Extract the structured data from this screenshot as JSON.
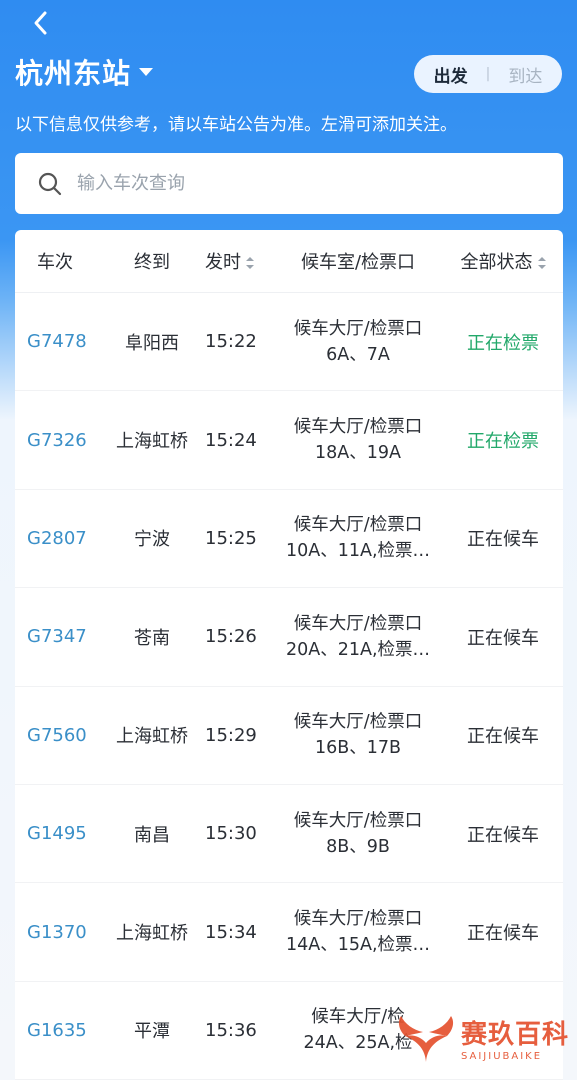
{
  "header": {
    "station": "杭州东站",
    "segment": {
      "departure": "出发",
      "separator": "|",
      "arrival": "到达"
    },
    "notice": "以下信息仅供参考，请以车站公告为准。左滑可添加关注。"
  },
  "search": {
    "placeholder": "输入车次查询"
  },
  "table": {
    "headers": {
      "train_no": "车次",
      "destination": "终到",
      "departure": "发时",
      "waiting_room": "候车室/检票口",
      "status": "全部状态"
    },
    "rows": [
      {
        "train_no": "G7478",
        "destination": "阜阳西",
        "time": "15:22",
        "room_line1": "候车大厅/检票口",
        "room_line2": "6A、7A",
        "status": "正在检票"
      },
      {
        "train_no": "G7326",
        "destination": "上海虹桥",
        "time": "15:24",
        "room_line1": "候车大厅/检票口",
        "room_line2": "18A、19A",
        "status": "正在检票"
      },
      {
        "train_no": "G2807",
        "destination": "宁波",
        "time": "15:25",
        "room_line1": "候车大厅/检票口",
        "room_line2": "10A、11A,检票…",
        "status": "正在候车"
      },
      {
        "train_no": "G7347",
        "destination": "苍南",
        "time": "15:26",
        "room_line1": "候车大厅/检票口",
        "room_line2": "20A、21A,检票…",
        "status": "正在候车"
      },
      {
        "train_no": "G7560",
        "destination": "上海虹桥",
        "time": "15:29",
        "room_line1": "候车大厅/检票口",
        "room_line2": "16B、17B",
        "status": "正在候车"
      },
      {
        "train_no": "G1495",
        "destination": "南昌",
        "time": "15:30",
        "room_line1": "候车大厅/检票口",
        "room_line2": "8B、9B",
        "status": "正在候车"
      },
      {
        "train_no": "G1370",
        "destination": "上海虹桥",
        "time": "15:34",
        "room_line1": "候车大厅/检票口",
        "room_line2": "14A、15A,检票…",
        "status": "正在候车"
      },
      {
        "train_no": "G1635",
        "destination": "平潭",
        "time": "15:36",
        "room_line1": "候车大厅/检",
        "room_line2": "24A、25A,检",
        "status": ""
      }
    ]
  },
  "watermark": {
    "cn": "赛玖百科",
    "en": "SAIJIUBAIKE"
  },
  "colors": {
    "header_blue": "#2f8cf1",
    "train_no": "#3a8fc8",
    "status_checking": "#22a86a",
    "status_waiting": "#2b2f36",
    "watermark": "#e4512e"
  }
}
